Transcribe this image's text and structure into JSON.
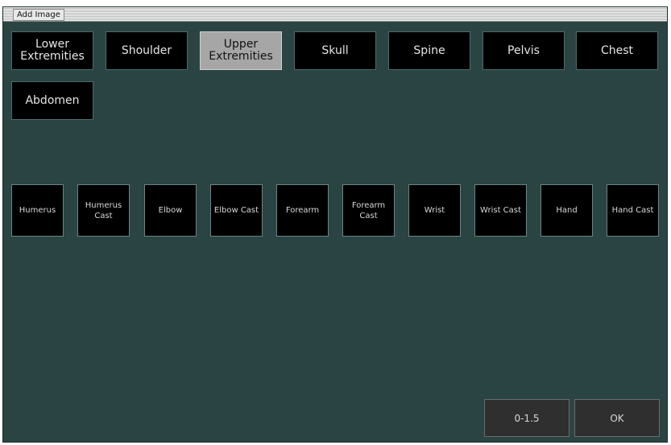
{
  "window": {
    "title": "Add Image"
  },
  "categories": [
    {
      "label": "Lower\nExtremities",
      "selected": false
    },
    {
      "label": "Shoulder",
      "selected": false
    },
    {
      "label": "Upper\nExtremities",
      "selected": true
    },
    {
      "label": "Skull",
      "selected": false
    },
    {
      "label": "Spine",
      "selected": false
    },
    {
      "label": "Pelvis",
      "selected": false
    },
    {
      "label": "Chest",
      "selected": false
    },
    {
      "label": "Abdomen",
      "selected": false
    }
  ],
  "subcategories": [
    {
      "label": "Humerus"
    },
    {
      "label": "Humerus\nCast"
    },
    {
      "label": "Elbow"
    },
    {
      "label": "Elbow Cast"
    },
    {
      "label": "Forearm"
    },
    {
      "label": "Forearm\nCast"
    },
    {
      "label": "Wrist"
    },
    {
      "label": "Wrist Cast"
    },
    {
      "label": "Hand"
    },
    {
      "label": "Hand Cast"
    }
  ],
  "actions": {
    "range_label": "0-1.5",
    "ok_label": "OK"
  },
  "colors": {
    "background": "#2a4444",
    "button": "#000000",
    "selected_button": "#a6a6a6"
  }
}
